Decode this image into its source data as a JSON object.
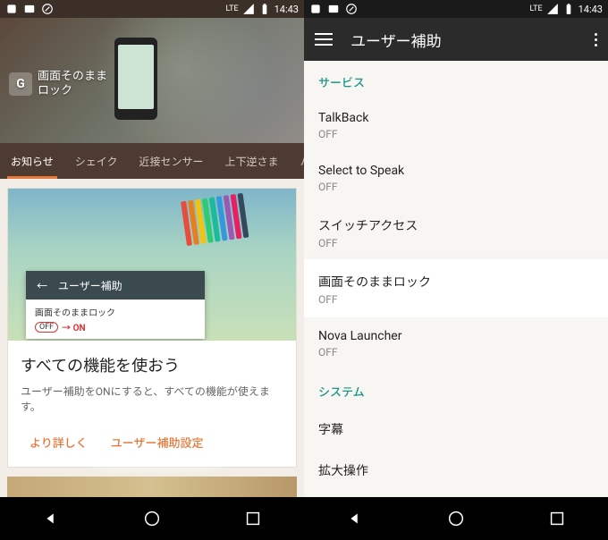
{
  "status": {
    "time": "14:43",
    "lte": "LTE"
  },
  "left": {
    "hero_title_l1": "画面そのまま",
    "hero_title_l2": "ロック",
    "tabs": [
      "お知らせ",
      "シェイク",
      "近接センサー",
      "上下逆さま",
      "ハード"
    ],
    "card": {
      "mini_title": "ユーザー補助",
      "mini_sub": "画面そのままロック",
      "off": "OFF",
      "on": "→ ON",
      "title": "すべての機能を使おう",
      "sub": "ユーザー補助をONにすると、すべての機能が使えます。",
      "more": "より詳しく",
      "settings": "ユーザー補助設定"
    }
  },
  "right": {
    "title": "ユーザー補助",
    "sub_services": "サービス",
    "sub_system": "システム",
    "off": "OFF",
    "items": {
      "talkback": "TalkBack",
      "select": "Select to Speak",
      "switch": "スイッチアクセス",
      "screen": "画面そのままロック",
      "nova": "Nova Launcher",
      "caption": "字幕",
      "magnify": "拡大操作"
    }
  }
}
